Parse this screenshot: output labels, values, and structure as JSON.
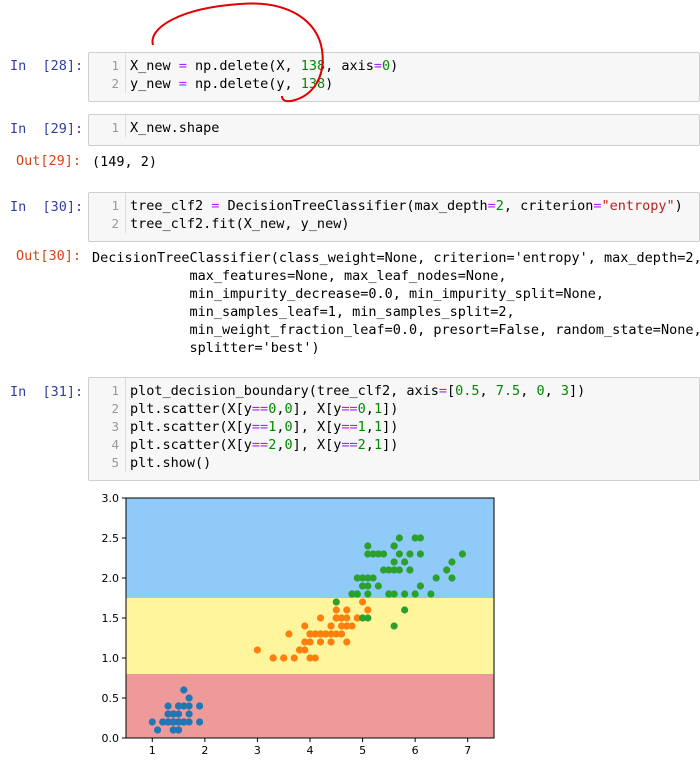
{
  "cells": [
    {
      "prompt": "In  [28]:",
      "line_numbers": [
        "1",
        "2"
      ],
      "lines": [
        [
          {
            "t": "X_new "
          },
          {
            "t": "=",
            "c": "op"
          },
          {
            "t": " np.delete(X, "
          },
          {
            "t": "138",
            "c": "num"
          },
          {
            "t": ", axis"
          },
          {
            "t": "=",
            "c": "op"
          },
          {
            "t": "0",
            "c": "num"
          },
          {
            "t": ")"
          }
        ],
        [
          {
            "t": "y_new "
          },
          {
            "t": "=",
            "c": "op"
          },
          {
            "t": " np.delete(y, "
          },
          {
            "t": "138",
            "c": "num"
          },
          {
            "t": ")"
          }
        ]
      ]
    },
    {
      "prompt": "In  [29]:",
      "line_numbers": [
        "1"
      ],
      "lines": [
        [
          {
            "t": "X_new.shape"
          }
        ]
      ]
    },
    {
      "prompt": "In  [30]:",
      "line_numbers": [
        "1",
        "2"
      ],
      "lines": [
        [
          {
            "t": "tree_clf2 "
          },
          {
            "t": "=",
            "c": "op"
          },
          {
            "t": " DecisionTreeClassifier(max_depth"
          },
          {
            "t": "=",
            "c": "op"
          },
          {
            "t": "2",
            "c": "num"
          },
          {
            "t": ", criterion"
          },
          {
            "t": "=",
            "c": "op"
          },
          {
            "t": "\"entropy\"",
            "c": "str"
          },
          {
            "t": ")"
          }
        ],
        [
          {
            "t": "tree_clf2.fit(X_new, y_new)"
          }
        ]
      ]
    },
    {
      "prompt": "In  [31]:",
      "line_numbers": [
        "1",
        "2",
        "3",
        "4",
        "5"
      ],
      "lines": [
        [
          {
            "t": "plot_decision_boundary(tree_clf2, axis"
          },
          {
            "t": "=",
            "c": "op"
          },
          {
            "t": "["
          },
          {
            "t": "0.5",
            "c": "num"
          },
          {
            "t": ", "
          },
          {
            "t": "7.5",
            "c": "num"
          },
          {
            "t": ", "
          },
          {
            "t": "0",
            "c": "num"
          },
          {
            "t": ", "
          },
          {
            "t": "3",
            "c": "num"
          },
          {
            "t": "])"
          }
        ],
        [
          {
            "t": "plt.scatter(X[y"
          },
          {
            "t": "==",
            "c": "op"
          },
          {
            "t": "0",
            "c": "num"
          },
          {
            "t": ","
          },
          {
            "t": "0",
            "c": "num"
          },
          {
            "t": "], X[y"
          },
          {
            "t": "==",
            "c": "op"
          },
          {
            "t": "0",
            "c": "num"
          },
          {
            "t": ","
          },
          {
            "t": "1",
            "c": "num"
          },
          {
            "t": "])"
          }
        ],
        [
          {
            "t": "plt.scatter(X[y"
          },
          {
            "t": "==",
            "c": "op"
          },
          {
            "t": "1",
            "c": "num"
          },
          {
            "t": ","
          },
          {
            "t": "0",
            "c": "num"
          },
          {
            "t": "], X[y"
          },
          {
            "t": "==",
            "c": "op"
          },
          {
            "t": "1",
            "c": "num"
          },
          {
            "t": ","
          },
          {
            "t": "1",
            "c": "num"
          },
          {
            "t": "])"
          }
        ],
        [
          {
            "t": "plt.scatter(X[y"
          },
          {
            "t": "==",
            "c": "op"
          },
          {
            "t": "2",
            "c": "num"
          },
          {
            "t": ","
          },
          {
            "t": "0",
            "c": "num"
          },
          {
            "t": "], X[y"
          },
          {
            "t": "==",
            "c": "op"
          },
          {
            "t": "2",
            "c": "num"
          },
          {
            "t": ","
          },
          {
            "t": "1",
            "c": "num"
          },
          {
            "t": "])"
          }
        ],
        [
          {
            "t": "plt.show()"
          }
        ]
      ]
    }
  ],
  "outputs": [
    {
      "prompt": "Out[29]:",
      "text": "(149, 2)"
    },
    {
      "prompt": "Out[30]:",
      "text": "DecisionTreeClassifier(class_weight=None, criterion='entropy', max_depth=2,\n            max_features=None, max_leaf_nodes=None,\n            min_impurity_decrease=0.0, min_impurity_split=None,\n            min_samples_leaf=1, min_samples_split=2,\n            min_weight_fraction_leaf=0.0, presort=False, random_state=None,\n            splitter='best')"
    }
  ],
  "colors": {
    "prompt_in": "#303F9F",
    "prompt_out": "#D84315",
    "region_0": "#EF9A9A",
    "region_1": "#FFF59D",
    "region_2": "#90CAF9",
    "class_0": "#1f77b4",
    "class_1": "#ff7f0e",
    "class_2": "#2ca02c",
    "annotation": "#e00000"
  },
  "chart_data": {
    "type": "scatter",
    "xlim": [
      0.5,
      7.5
    ],
    "ylim": [
      0,
      3
    ],
    "x_ticks": [
      "1",
      "2",
      "3",
      "4",
      "5",
      "6",
      "7"
    ],
    "y_ticks": [
      "0.0",
      "0.5",
      "1.0",
      "1.5",
      "2.0",
      "2.5",
      "3.0"
    ],
    "decision_regions": [
      {
        "class": 0,
        "y_range": [
          0,
          0.8
        ]
      },
      {
        "class": 1,
        "y_range": [
          0.8,
          1.75
        ]
      },
      {
        "class": 2,
        "y_range": [
          1.75,
          3
        ]
      }
    ],
    "series": [
      {
        "points": [
          [
            1.4,
            0.2
          ],
          [
            1.4,
            0.2
          ],
          [
            1.3,
            0.2
          ],
          [
            1.5,
            0.2
          ],
          [
            1.4,
            0.2
          ],
          [
            1.7,
            0.4
          ],
          [
            1.4,
            0.3
          ],
          [
            1.5,
            0.2
          ],
          [
            1.4,
            0.2
          ],
          [
            1.5,
            0.1
          ],
          [
            1.5,
            0.2
          ],
          [
            1.6,
            0.2
          ],
          [
            1.4,
            0.1
          ],
          [
            1.1,
            0.1
          ],
          [
            1.2,
            0.2
          ],
          [
            1.5,
            0.4
          ],
          [
            1.3,
            0.4
          ],
          [
            1.4,
            0.3
          ],
          [
            1.7,
            0.3
          ],
          [
            1.5,
            0.3
          ],
          [
            1.7,
            0.2
          ],
          [
            1.5,
            0.4
          ],
          [
            1.0,
            0.2
          ],
          [
            1.7,
            0.5
          ],
          [
            1.9,
            0.2
          ],
          [
            1.6,
            0.2
          ],
          [
            1.6,
            0.4
          ],
          [
            1.5,
            0.2
          ],
          [
            1.4,
            0.2
          ],
          [
            1.6,
            0.2
          ],
          [
            1.6,
            0.2
          ],
          [
            1.5,
            0.4
          ],
          [
            1.5,
            0.1
          ],
          [
            1.4,
            0.2
          ],
          [
            1.5,
            0.2
          ],
          [
            1.2,
            0.2
          ],
          [
            1.3,
            0.2
          ],
          [
            1.4,
            0.1
          ],
          [
            1.3,
            0.2
          ],
          [
            1.5,
            0.2
          ],
          [
            1.3,
            0.3
          ],
          [
            1.3,
            0.3
          ],
          [
            1.3,
            0.2
          ],
          [
            1.6,
            0.6
          ],
          [
            1.9,
            0.4
          ],
          [
            1.4,
            0.3
          ],
          [
            1.6,
            0.2
          ],
          [
            1.4,
            0.2
          ],
          [
            1.5,
            0.2
          ],
          [
            1.4,
            0.2
          ]
        ]
      },
      {
        "points": [
          [
            4.7,
            1.4
          ],
          [
            4.5,
            1.5
          ],
          [
            4.9,
            1.5
          ],
          [
            4.0,
            1.3
          ],
          [
            4.6,
            1.5
          ],
          [
            4.5,
            1.3
          ],
          [
            4.7,
            1.6
          ],
          [
            3.3,
            1.0
          ],
          [
            4.6,
            1.3
          ],
          [
            3.9,
            1.4
          ],
          [
            3.5,
            1.0
          ],
          [
            4.2,
            1.5
          ],
          [
            4.0,
            1.0
          ],
          [
            4.7,
            1.4
          ],
          [
            3.6,
            1.3
          ],
          [
            4.4,
            1.4
          ],
          [
            4.5,
            1.5
          ],
          [
            4.1,
            1.0
          ],
          [
            4.5,
            1.5
          ],
          [
            3.9,
            1.1
          ],
          [
            4.8,
            1.8
          ],
          [
            4.0,
            1.3
          ],
          [
            4.9,
            1.5
          ],
          [
            4.7,
            1.2
          ],
          [
            4.3,
            1.3
          ],
          [
            4.4,
            1.4
          ],
          [
            4.8,
            1.4
          ],
          [
            5.0,
            1.7
          ],
          [
            4.5,
            1.5
          ],
          [
            3.5,
            1.0
          ],
          [
            3.8,
            1.1
          ],
          [
            3.7,
            1.0
          ],
          [
            3.9,
            1.2
          ],
          [
            5.1,
            1.6
          ],
          [
            4.5,
            1.5
          ],
          [
            4.5,
            1.6
          ],
          [
            4.7,
            1.5
          ],
          [
            4.4,
            1.3
          ],
          [
            4.1,
            1.3
          ],
          [
            4.0,
            1.3
          ],
          [
            4.4,
            1.2
          ],
          [
            4.6,
            1.4
          ],
          [
            4.0,
            1.2
          ],
          [
            3.3,
            1.0
          ],
          [
            4.2,
            1.3
          ],
          [
            4.2,
            1.2
          ],
          [
            4.2,
            1.3
          ],
          [
            4.3,
            1.3
          ],
          [
            3.0,
            1.1
          ],
          [
            4.1,
            1.3
          ]
        ]
      },
      {
        "points": [
          [
            6.0,
            2.5
          ],
          [
            5.1,
            1.9
          ],
          [
            5.9,
            2.1
          ],
          [
            5.6,
            1.8
          ],
          [
            5.8,
            2.2
          ],
          [
            6.6,
            2.1
          ],
          [
            4.5,
            1.7
          ],
          [
            6.3,
            1.8
          ],
          [
            5.8,
            1.8
          ],
          [
            6.1,
            2.5
          ],
          [
            5.1,
            2.0
          ],
          [
            5.3,
            1.9
          ],
          [
            5.5,
            2.1
          ],
          [
            5.0,
            2.0
          ],
          [
            5.1,
            2.4
          ],
          [
            5.3,
            2.3
          ],
          [
            5.5,
            1.8
          ],
          [
            6.7,
            2.2
          ],
          [
            6.9,
            2.3
          ],
          [
            5.0,
            1.5
          ],
          [
            5.7,
            2.3
          ],
          [
            4.9,
            2.0
          ],
          [
            6.7,
            2.0
          ],
          [
            4.9,
            1.8
          ],
          [
            5.7,
            2.1
          ],
          [
            6.0,
            1.8
          ],
          [
            4.8,
            1.8
          ],
          [
            4.9,
            1.8
          ],
          [
            5.6,
            2.1
          ],
          [
            5.8,
            1.6
          ],
          [
            6.1,
            1.9
          ],
          [
            6.4,
            2.0
          ],
          [
            5.6,
            2.2
          ],
          [
            5.1,
            1.5
          ],
          [
            5.6,
            1.4
          ],
          [
            6.1,
            2.3
          ],
          [
            5.6,
            2.4
          ],
          [
            5.5,
            1.8
          ],
          [
            4.8,
            1.8
          ],
          [
            5.4,
            2.1
          ],
          [
            5.6,
            2.4
          ],
          [
            5.1,
            2.3
          ],
          [
            5.9,
            2.3
          ],
          [
            5.7,
            2.5
          ],
          [
            5.2,
            2.3
          ],
          [
            5.0,
            1.9
          ],
          [
            5.2,
            2.0
          ],
          [
            5.4,
            2.3
          ],
          [
            5.1,
            1.8
          ]
        ]
      }
    ]
  }
}
